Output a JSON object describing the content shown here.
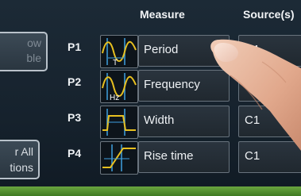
{
  "header": {
    "measure": "Measure",
    "source": "Source(s)"
  },
  "side_buttons": [
    {
      "line1": "ow",
      "line2": "ble"
    },
    {
      "line1": "r All",
      "line2": "tions"
    }
  ],
  "rows": [
    {
      "label": "P1",
      "icon": "period-icon",
      "icon_text": "T",
      "measure": "Period",
      "source": "C1"
    },
    {
      "label": "P2",
      "icon": "frequency-icon",
      "icon_text": "Hz",
      "measure": "Frequency",
      "source": ""
    },
    {
      "label": "P3",
      "icon": "width-icon",
      "icon_text": "",
      "measure": "Width",
      "source": "C1"
    },
    {
      "label": "P4",
      "icon": "rise-time-icon",
      "icon_text": "",
      "measure": "Rise time",
      "source": "C1"
    }
  ],
  "colors": {
    "accent_green": "#5c9a36",
    "waveform": "#e8c020",
    "marker": "#3fa0e0"
  }
}
